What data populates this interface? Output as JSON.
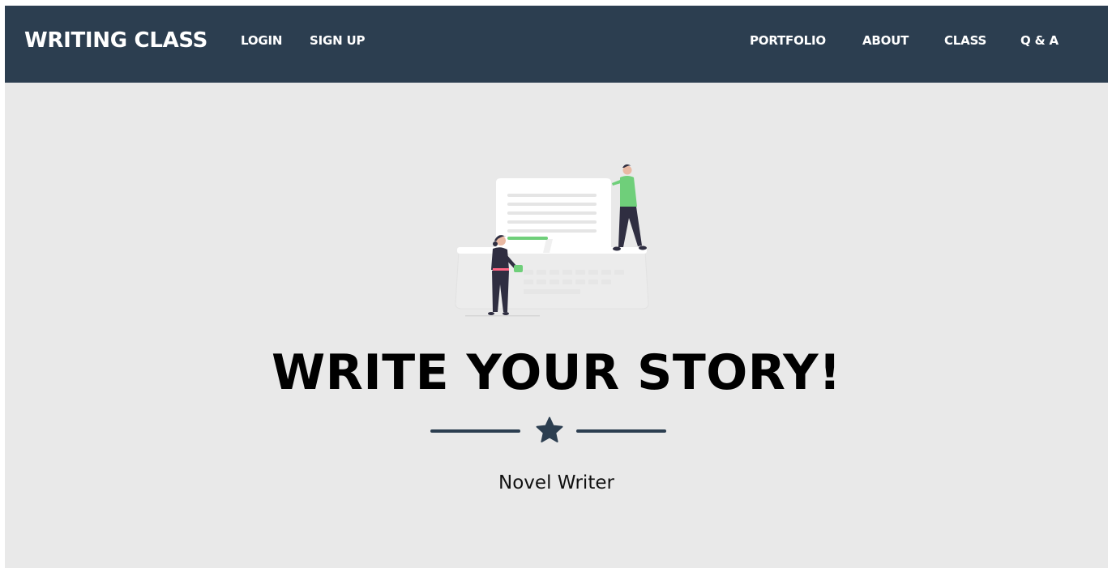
{
  "navbar": {
    "brand": "WRITING CLASS",
    "left_links": {
      "login": "LOGIN",
      "signup": "SIGN UP"
    },
    "right_links": {
      "portfolio": "PORTFOLIO",
      "about": "ABOUT",
      "class": "CLASS",
      "qa": "Q & A"
    }
  },
  "hero": {
    "illustration_icon": "writing-illustration",
    "headline": "WRITE YOUR STORY!",
    "divider_icon": "star-icon",
    "subtitle": "Novel Writer"
  },
  "colors": {
    "navbar_bg": "#2c3e50",
    "page_bg": "#e9e9e9",
    "accent_green": "#6fcf7a"
  }
}
